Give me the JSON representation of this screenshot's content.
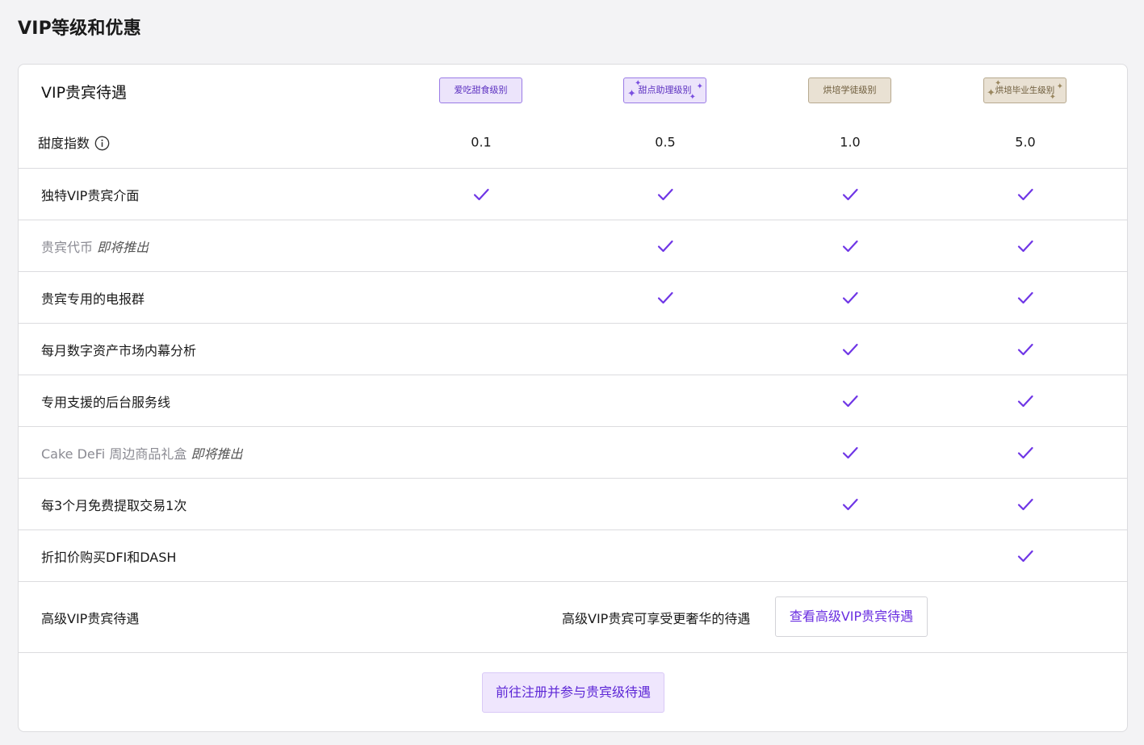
{
  "page": {
    "title": "VIP等级和优惠"
  },
  "header": {
    "title": "VIP贵宾待遇",
    "tiers": [
      {
        "label": "爱吃甜食级别"
      },
      {
        "label": "甜点助理级别"
      },
      {
        "label": "烘培学徒级别"
      },
      {
        "label": "烘培毕业生级别"
      }
    ]
  },
  "sweetness": {
    "label": "甜度指数",
    "values": [
      "0.1",
      "0.5",
      "1.0",
      "5.0"
    ]
  },
  "benefits": [
    {
      "label": "独特VIP贵宾介面",
      "soon": "",
      "muted": false,
      "tiers": [
        true,
        true,
        true,
        true
      ]
    },
    {
      "label": "贵宾代币 ",
      "soon": "即将推出",
      "muted": true,
      "tiers": [
        false,
        true,
        true,
        true
      ]
    },
    {
      "label": "贵宾专用的电报群",
      "soon": "",
      "muted": false,
      "tiers": [
        false,
        true,
        true,
        true
      ]
    },
    {
      "label": "每月数字资产市场内幕分析",
      "soon": "",
      "muted": false,
      "tiers": [
        false,
        false,
        true,
        true
      ]
    },
    {
      "label": "专用支援的后台服务线",
      "soon": "",
      "muted": false,
      "tiers": [
        false,
        false,
        true,
        true
      ]
    },
    {
      "label": "Cake DeFi 周边商品礼盒 ",
      "soon": "即将推出",
      "muted": true,
      "tiers": [
        false,
        false,
        true,
        true
      ]
    },
    {
      "label": "每3个月免费提取交易1次",
      "soon": "",
      "muted": false,
      "tiers": [
        false,
        false,
        true,
        true
      ]
    },
    {
      "label": "折扣价购买DFI和DASH",
      "soon": "",
      "muted": false,
      "tiers": [
        false,
        false,
        false,
        true
      ]
    }
  ],
  "advanced": {
    "label": "高级VIP贵宾待遇",
    "description": "高级VIP贵宾可享受更奢华的待遇",
    "button_label": "查看高级VIP贵宾待遇"
  },
  "footer": {
    "cta_label": "前往注册并参与贵宾级待遇"
  },
  "colors": {
    "accent": "#6a2ee0",
    "check": "#6f36e6",
    "border": "#dcdcdf",
    "background": "#f3f3f5"
  },
  "icons": {
    "check": "check-icon",
    "info": "info-icon",
    "sparkle": "sparkle-icon"
  }
}
